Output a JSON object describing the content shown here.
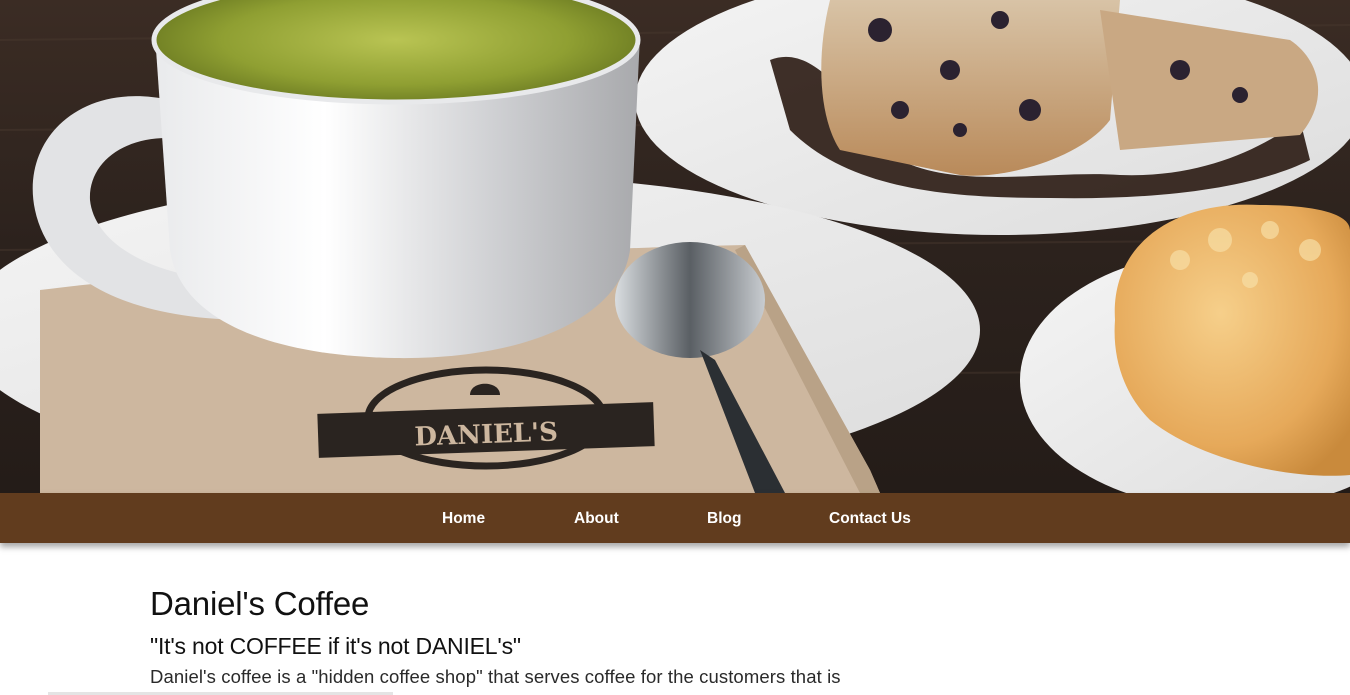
{
  "hero": {
    "napkin_logo_text": "DANIEL'S"
  },
  "nav": {
    "items": [
      {
        "label": "Home"
      },
      {
        "label": "About"
      },
      {
        "label": "Blog"
      },
      {
        "label": "Contact Us"
      }
    ]
  },
  "main": {
    "title": "Daniel's Coffee",
    "tagline": "\"It's not COFFEE if it's not DANIEL's\"",
    "intro": "Daniel's coffee is a \"hidden coffee shop\" that serves coffee for the customers that is"
  },
  "colors": {
    "nav_background": "#613c1e",
    "nav_text": "#ffffff",
    "heading_text": "#111111"
  }
}
